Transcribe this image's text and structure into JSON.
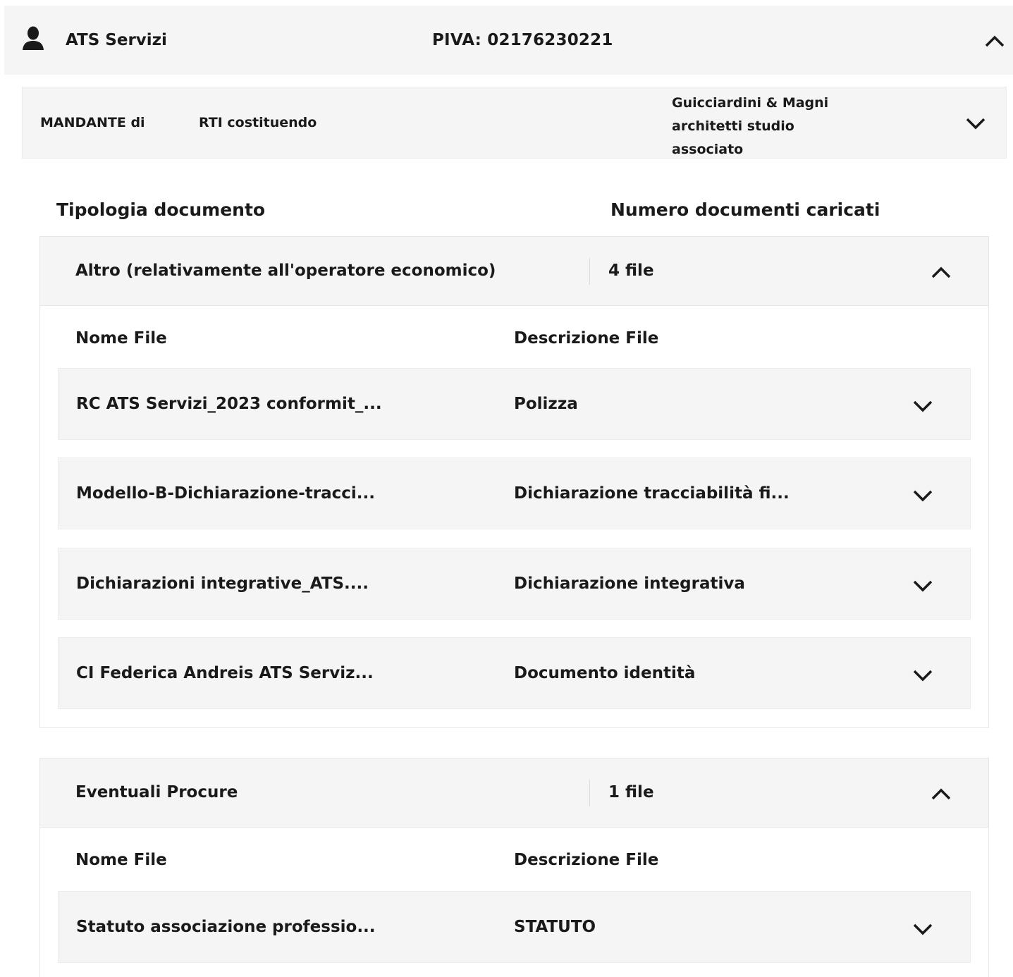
{
  "operator": {
    "name": "ATS Servizi",
    "piva": "PIVA: 02176230221",
    "icon": "user-icon",
    "toggle_icon": "chevron-up-icon"
  },
  "rti": {
    "role": "MANDANTE di",
    "type": "RTI costituendo",
    "name": "Guicciardini & Magni architetti studio associato",
    "toggle_icon": "chevron-down-icon"
  },
  "columns": {
    "doc_type": "Tipologia documento",
    "doc_count": "Numero documenti caricati"
  },
  "groups": [
    {
      "title": "Altro (relativamente all'operatore economico)",
      "count": "4 file",
      "name_header": "Nome File",
      "desc_header": "Descrizione File",
      "files": [
        {
          "name": "RC ATS Servizi_2023 conformit_...",
          "description": "Polizza"
        },
        {
          "name": "Modello-B-Dichiarazione-tracci...",
          "description": "Dichiarazione tracciabilità fi..."
        },
        {
          "name": "Dichiarazioni integrative_ATS....",
          "description": "Dichiarazione integrativa"
        },
        {
          "name": "CI Federica Andreis ATS Serviz...",
          "description": "Documento identità"
        }
      ]
    },
    {
      "title": "Eventuali Procure",
      "count": "1 file",
      "name_header": "Nome File",
      "desc_header": "Descrizione File",
      "files": [
        {
          "name": "Statuto associazione professio...",
          "description": "STATUTO"
        }
      ]
    }
  ]
}
